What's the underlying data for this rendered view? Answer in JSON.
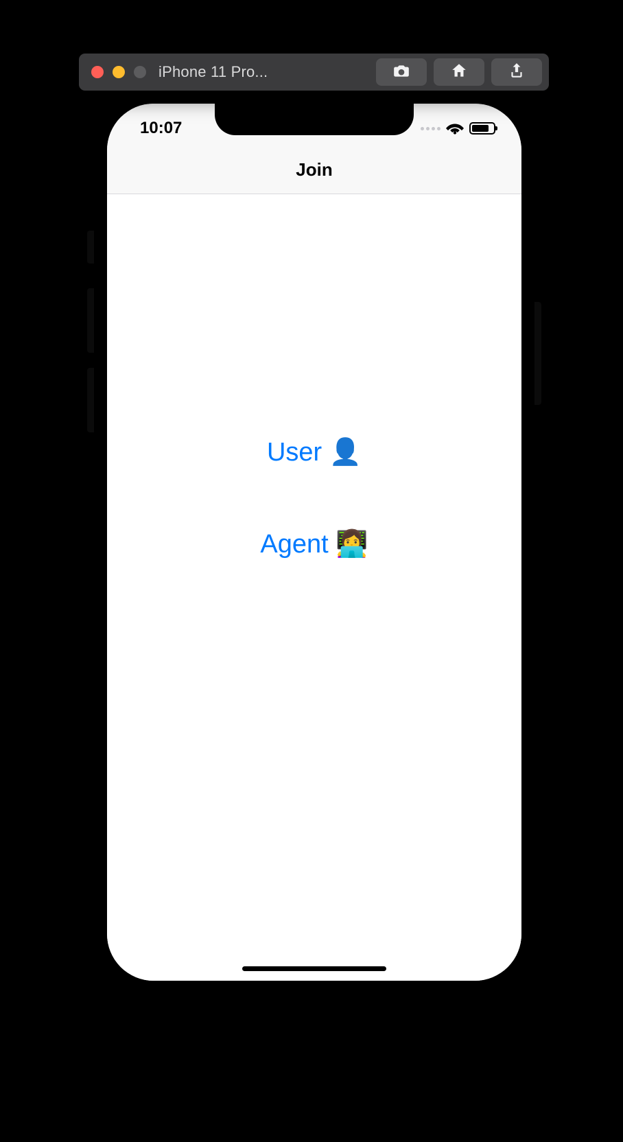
{
  "simulator": {
    "title": "iPhone 11 Pro..."
  },
  "statusbar": {
    "time": "10:07"
  },
  "navbar": {
    "title": "Join"
  },
  "choices": {
    "user": "User 👤",
    "agent": "Agent 👩‍💻"
  }
}
